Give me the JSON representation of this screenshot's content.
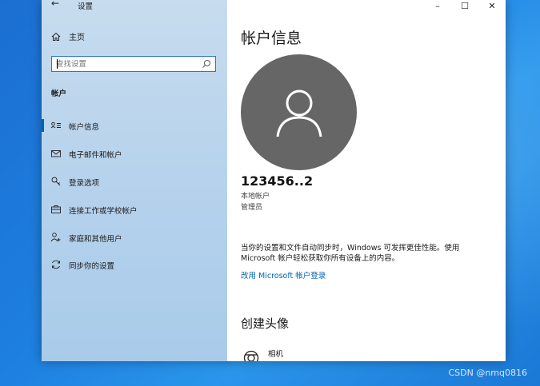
{
  "window": {
    "title": "设置",
    "back_symbol": "←",
    "controls": {
      "minimize": "–",
      "maximize": "☐",
      "close": "✕"
    }
  },
  "sidebar": {
    "home_label": "主页",
    "search_placeholder": "查找设置",
    "section_label": "帐户",
    "items": [
      {
        "label": "帐户信息",
        "icon": "account-info-icon",
        "active": true
      },
      {
        "label": "电子邮件和帐户",
        "icon": "mail-icon",
        "active": false
      },
      {
        "label": "登录选项",
        "icon": "key-icon",
        "active": false
      },
      {
        "label": "连接工作或学校帐户",
        "icon": "briefcase-icon",
        "active": false
      },
      {
        "label": "家庭和其他用户",
        "icon": "add-person-icon",
        "active": false
      },
      {
        "label": "同步你的设置",
        "icon": "sync-icon",
        "active": false
      }
    ]
  },
  "main": {
    "title": "帐户信息",
    "username": "123456..2",
    "account_type": "本地帐户",
    "account_role": "管理员",
    "sync_description": "当你的设置和文件自动同步时，Windows 可发挥更佳性能。使用 Microsoft 帐户轻松获取你所有设备上的内容。",
    "ms_link": "改用 Microsoft 帐户登录",
    "create_avatar_heading": "创建头像",
    "camera_label": "相机"
  },
  "desktop": {
    "watermark": "CSDN @nmq0816"
  },
  "colors": {
    "accent": "#0063b1",
    "avatar_bg": "#666666",
    "sidebar_bg": "#b6d2ec"
  }
}
